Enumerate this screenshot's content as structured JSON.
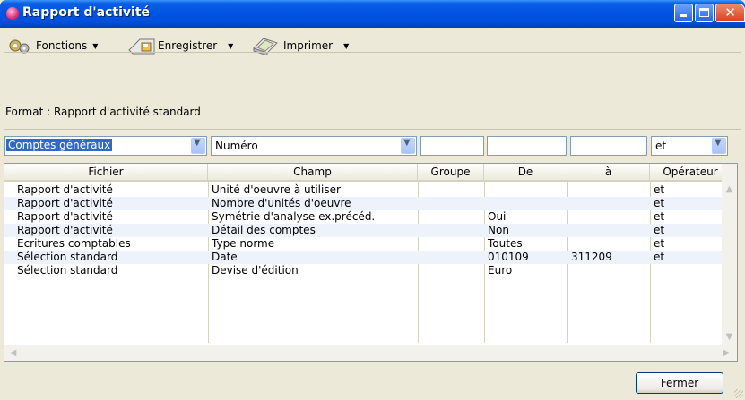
{
  "window": {
    "title": "Rapport d'activité"
  },
  "toolbar": {
    "fonctions": "Fonctions",
    "enregistrer": "Enregistrer",
    "imprimer": "Imprimer"
  },
  "format": {
    "label": "Format : Rapport d'activité standard"
  },
  "filters": {
    "compte": "Comptes généraux",
    "champ": "Numéro",
    "operateur": "et"
  },
  "table": {
    "headers": [
      "Fichier",
      "Champ",
      "Groupe",
      "De",
      "à",
      "Opérateur"
    ],
    "rows": [
      [
        "Rapport d'activité",
        "Unité d'oeuvre à utiliser",
        "",
        "",
        "",
        "et"
      ],
      [
        "Rapport d'activité",
        "Nombre d'unités d'oeuvre",
        "",
        "",
        "",
        "et"
      ],
      [
        "Rapport d'activité",
        "Symétrie d'analyse ex.précéd.",
        "",
        "Oui",
        "",
        "et"
      ],
      [
        "Rapport d'activité",
        "Détail des comptes",
        "",
        "Non",
        "",
        "et"
      ],
      [
        "Ecritures comptables",
        "Type norme",
        "",
        "Toutes",
        "",
        "et"
      ],
      [
        "Sélection standard",
        "Date",
        "",
        "010109",
        "311209",
        "et"
      ],
      [
        "Sélection standard",
        "Devise d'édition",
        "",
        "Euro",
        "",
        ""
      ]
    ]
  },
  "buttons": {
    "fermer": "Fermer"
  }
}
